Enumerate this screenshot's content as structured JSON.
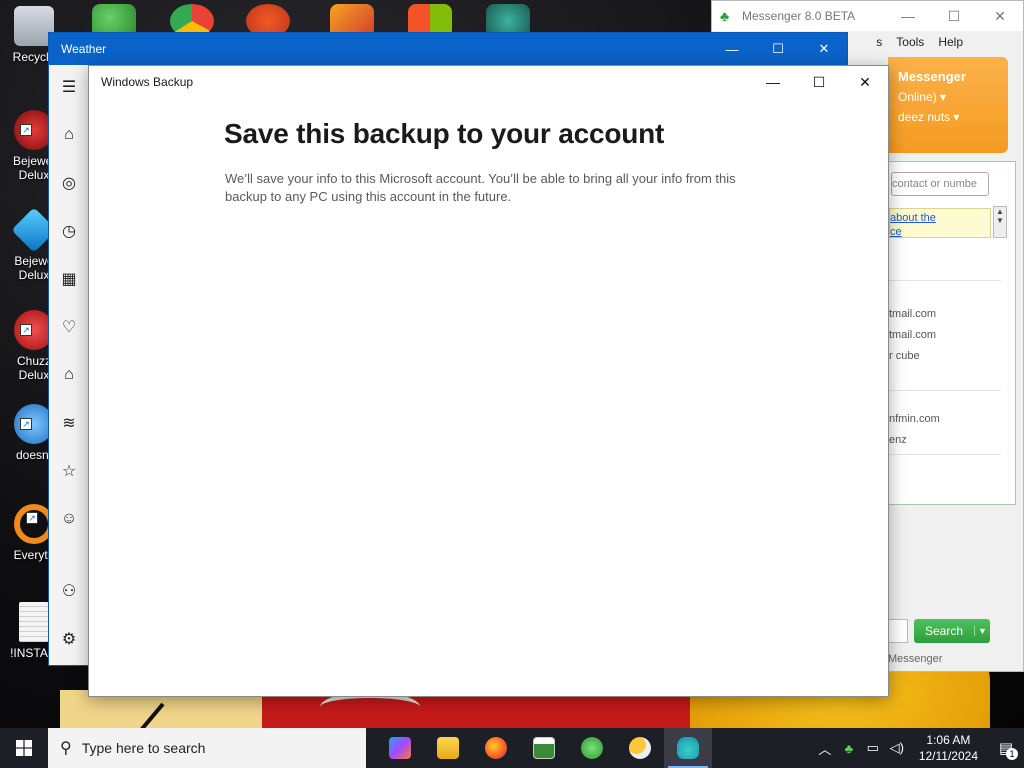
{
  "desktop": {
    "icons": [
      {
        "label": "Recycle"
      },
      {
        "label": "Bejewel Delux"
      },
      {
        "label": "Bejewe Delux"
      },
      {
        "label": "Chuzz Delux"
      },
      {
        "label": "doesnt"
      },
      {
        "label": "Everyth"
      },
      {
        "label": "!INSTALI"
      }
    ]
  },
  "messenger": {
    "title": "Messenger 8.0 BETA",
    "menu": [
      "Tools",
      "Help"
    ],
    "menu_partial": "s",
    "header_title": "Messenger",
    "header_status": "Online)",
    "header_name": "deez nuts",
    "search_placeholder": "contact or numbe",
    "link_line1": "about the",
    "link_line2": "ce",
    "contacts": [
      "tmail.com",
      "tmail.com",
      "r cube",
      "nfmin.com",
      "enz"
    ],
    "search_button": "Search",
    "status_text": "Messenger"
  },
  "weather": {
    "title": "Weather"
  },
  "backup": {
    "title": "Windows Backup",
    "heading": "Save this backup to your account",
    "body": "We’ll save your info to this Microsoft account. You’ll be able to bring all your info from this backup to any PC using this account in the future."
  },
  "taskbar": {
    "search_placeholder": "Type here to search",
    "time": "1:06 AM",
    "date": "12/11/2024",
    "notification_count": "1"
  },
  "colors": {
    "taskbar_bg": "#1c1f26",
    "weather_titlebar": "#0a63c9",
    "messenger_orange": "#f59b22",
    "messenger_green": "#2e9e3c"
  }
}
